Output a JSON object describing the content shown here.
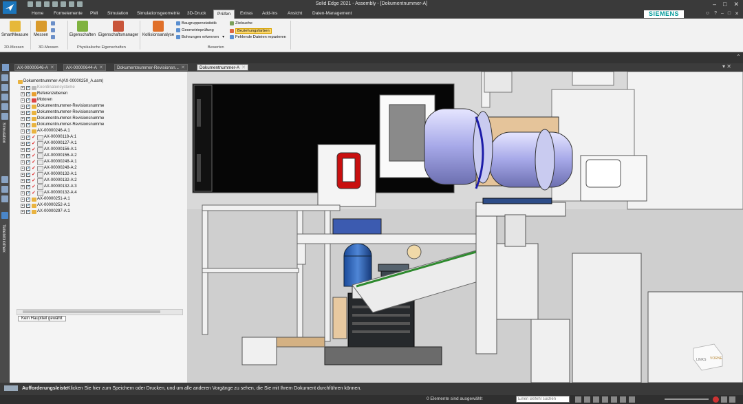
{
  "window": {
    "title": "Solid Edge 2021 - Assembly - [Dokumentnummer-A]",
    "controls": [
      "–",
      "□",
      "✕"
    ]
  },
  "ribbon_tabs": [
    "Home",
    "Formelemente",
    "PMI",
    "Simulation",
    "Simulationsgeometrie",
    "3D-Druck",
    "Prüfen",
    "Extras",
    "Add-Ins",
    "Ansicht",
    "Daten-Management"
  ],
  "active_tab": "Prüfen",
  "brand": "SIEMENS",
  "ribbon": {
    "smart_measure": "SmartMeasure",
    "messen": "Messen",
    "eigenschaften": "Eigenschaften",
    "eigenschaftsmanager": "Eigenschaftsmanager",
    "kollisionsanalyse": "Kollisionsanalyse",
    "baugruppenstatistik": "Baugruppenstatistik",
    "geometriepruefung": "Geometrieprüfung",
    "bohrungen_erkennen": "Bohrungen erkennen",
    "zielsuche": "Zielsuche",
    "beziehungsfarben": "Beziehungsfarben",
    "fehlende_dateien": "Fehlende Dateien reparieren",
    "groups": [
      "2D-Messen",
      "3D-Messen",
      "Physikalische Eigenschaften",
      "Bewerten"
    ]
  },
  "doc_tabs": [
    {
      "label": "AX-00000646-A",
      "active": false
    },
    {
      "label": "AX-00000644-A",
      "active": false
    },
    {
      "label": "Dokumentnummer-Revisionsn...",
      "active": false
    },
    {
      "label": "Dokumentnummer-A",
      "active": true
    }
  ],
  "left_panels": [
    "Simulation",
    "Teilebibliothek"
  ],
  "tree": {
    "root": "Dokumentnummer-A(AX-00000250_A.asm)",
    "items": [
      {
        "label": "Koordinatensysteme",
        "kind": "dim"
      },
      {
        "label": "Referenzebenen",
        "kind": "ref"
      },
      {
        "label": "Motoren",
        "kind": "motor"
      },
      {
        "label": "Dokumentnummer-Revisionsnumme",
        "kind": "asm"
      },
      {
        "label": "Dokumentnummer-Revisionsnumme",
        "kind": "asm"
      },
      {
        "label": "Dokumentnummer-Revisionsnumme",
        "kind": "asm"
      },
      {
        "label": "Dokumentnummer-Revisionsnumme",
        "kind": "asm"
      },
      {
        "label": "AX-00000246-A:1",
        "kind": "asm"
      },
      {
        "label": "AX-00000118-A:1",
        "kind": "part"
      },
      {
        "label": "AX-00000127-A:1",
        "kind": "part"
      },
      {
        "label": "AX-00000156-A:1",
        "kind": "part"
      },
      {
        "label": "AX-00000156-A:2",
        "kind": "part"
      },
      {
        "label": "AX-00000248-A:1",
        "kind": "part"
      },
      {
        "label": "AX-00000248-A:2",
        "kind": "part"
      },
      {
        "label": "AX-00000132-A:1",
        "kind": "part"
      },
      {
        "label": "AX-00000132-A:2",
        "kind": "part"
      },
      {
        "label": "AX-00000132-A:3",
        "kind": "part"
      },
      {
        "label": "AX-00000132-A:4",
        "kind": "part"
      },
      {
        "label": "AX-00000251-A:1",
        "kind": "asm"
      },
      {
        "label": "AX-00000252-A:1",
        "kind": "asm"
      },
      {
        "label": "AX-00000297-A:1",
        "kind": "asm"
      }
    ],
    "status": "Kein Hauptteil gewählt"
  },
  "viewcube": {
    "left": "LINKS",
    "front": "VORNE"
  },
  "prompt": {
    "label": "Aufforderungsleiste",
    "message": "Klicken Sie hier zum Speichern oder Drucken, und um alle anderen Vorgänge zu sehen, die Sie mit Ihrem Dokument durchführen können."
  },
  "status": {
    "selection": "0 Elemente sind ausgewählt",
    "search_placeholder": "Einen Befehl suchen"
  },
  "colors": {
    "accent": "#00a0c8",
    "highlight": "#ffd86b",
    "brand": "#009999"
  }
}
